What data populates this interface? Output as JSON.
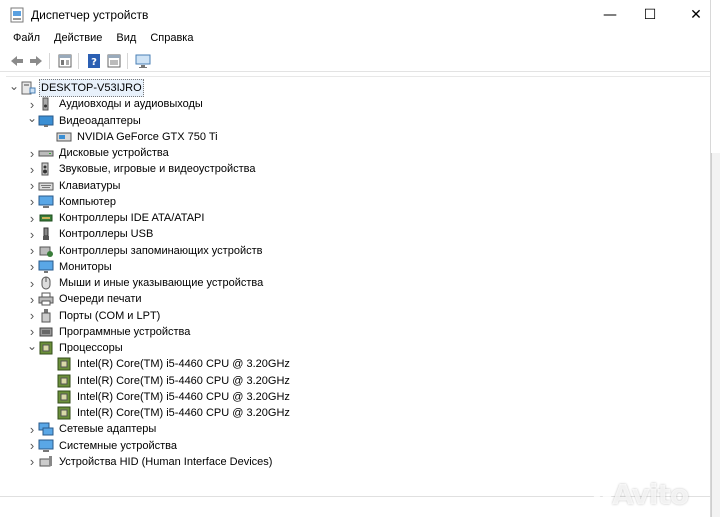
{
  "window": {
    "title": "Диспетчер устройств",
    "controls": {
      "minimize": "—",
      "maximize": "☐",
      "close": "✕"
    }
  },
  "menu": [
    "Файл",
    "Действие",
    "Вид",
    "Справка"
  ],
  "toolbar": [
    "back-icon",
    "forward-icon",
    "properties-icon",
    "help-icon",
    "action-icon",
    "monitor-scan-icon"
  ],
  "tree": {
    "root": "DESKTOP-V53IJRO",
    "items": [
      {
        "label": "Аудиовходы и аудиовыходы",
        "icon": "audio-icon",
        "expanded": false,
        "children": []
      },
      {
        "label": "Видеоадаптеры",
        "icon": "display-adapter-icon",
        "expanded": true,
        "children": [
          "NVIDIA GeForce GTX 750 Ti"
        ]
      },
      {
        "label": "Дисковые устройства",
        "icon": "disk-icon",
        "expanded": false,
        "children": []
      },
      {
        "label": "Звуковые, игровые и видеоустройства",
        "icon": "sound-icon",
        "expanded": false,
        "children": []
      },
      {
        "label": "Клавиатуры",
        "icon": "keyboard-icon",
        "expanded": false,
        "children": []
      },
      {
        "label": "Компьютер",
        "icon": "computer-icon",
        "expanded": false,
        "children": []
      },
      {
        "label": "Контроллеры IDE ATA/ATAPI",
        "icon": "ide-icon",
        "expanded": false,
        "children": []
      },
      {
        "label": "Контроллеры USB",
        "icon": "usb-icon",
        "expanded": false,
        "children": []
      },
      {
        "label": "Контроллеры запоминающих устройств",
        "icon": "storage-icon",
        "expanded": false,
        "children": []
      },
      {
        "label": "Мониторы",
        "icon": "monitor-icon",
        "expanded": false,
        "children": []
      },
      {
        "label": "Мыши и иные указывающие устройства",
        "icon": "mouse-icon",
        "expanded": false,
        "children": []
      },
      {
        "label": "Очереди печати",
        "icon": "printer-icon",
        "expanded": false,
        "children": []
      },
      {
        "label": "Порты (COM и LPT)",
        "icon": "port-icon",
        "expanded": false,
        "children": []
      },
      {
        "label": "Программные устройства",
        "icon": "software-device-icon",
        "expanded": false,
        "children": []
      },
      {
        "label": "Процессоры",
        "icon": "processor-icon",
        "expanded": true,
        "children": [
          "Intel(R) Core(TM) i5-4460  CPU @ 3.20GHz",
          "Intel(R) Core(TM) i5-4460  CPU @ 3.20GHz",
          "Intel(R) Core(TM) i5-4460  CPU @ 3.20GHz",
          "Intel(R) Core(TM) i5-4460  CPU @ 3.20GHz"
        ]
      },
      {
        "label": "Сетевые адаптеры",
        "icon": "network-icon",
        "expanded": false,
        "children": []
      },
      {
        "label": "Системные устройства",
        "icon": "system-device-icon",
        "expanded": false,
        "children": []
      },
      {
        "label": "Устройства HID (Human Interface Devices)",
        "icon": "hid-icon",
        "expanded": false,
        "children": []
      }
    ]
  },
  "watermark": "Avito"
}
